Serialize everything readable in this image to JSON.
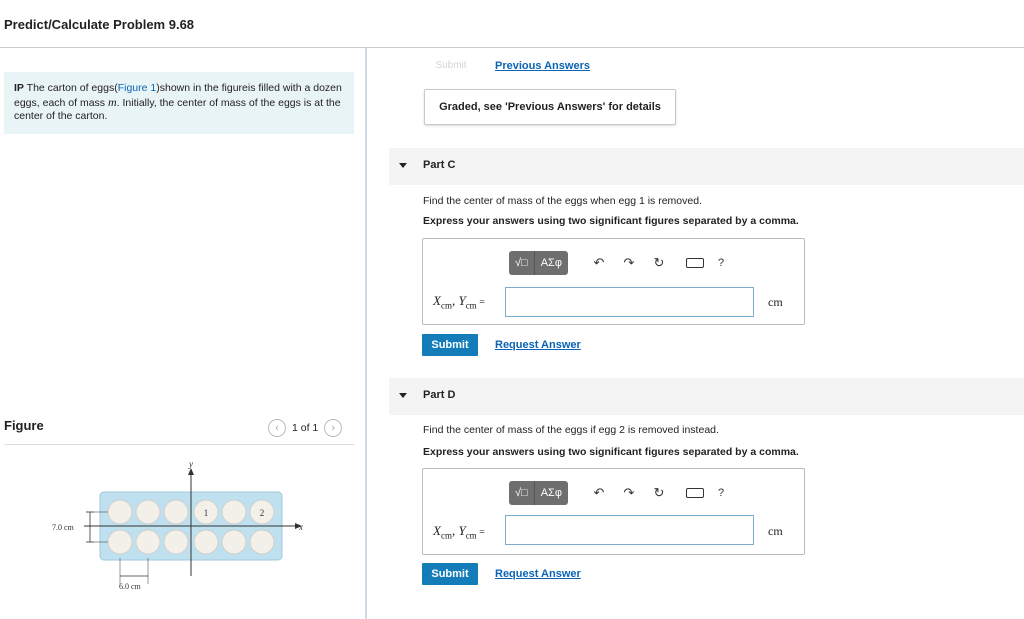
{
  "header": {
    "title": "Predict/Calculate Problem 9.68"
  },
  "intro": {
    "prefix": "IP",
    "text_before_link": " The carton of eggs(",
    "link": "Figure 1",
    "text_after_link": ")shown in the figureis filled with a dozen eggs, each of mass ",
    "mass_symbol": "m",
    "text_end": ". Initially, the center of mass of the eggs is at the center of the carton."
  },
  "figure": {
    "heading": "Figure",
    "pager": "1 of 1",
    "prev_icon": "chevron-left-icon",
    "next_icon": "chevron-right-icon",
    "axis_x": "x",
    "axis_y": "y",
    "height_label": "7.0 cm",
    "width_label": "6.0 cm",
    "egg_1": "1",
    "egg_2": "2"
  },
  "top": {
    "submit_label": "Submit",
    "previous_answers": "Previous Answers",
    "graded": "Graded, see 'Previous Answers' for details"
  },
  "parts": [
    {
      "label": "Part C",
      "question": "Find the center of mass of the eggs when egg 1 is removed.",
      "instruction": "Express your answers using two significant figures separated by a comma.",
      "var_x": "X",
      "sub_x": "cm",
      "var_y": "Y",
      "sub_y": "cm",
      "equals": " =",
      "unit": "cm",
      "submit": "Submit",
      "request": "Request Answer"
    },
    {
      "label": "Part D",
      "question": "Find the center of mass of the eggs if egg 2 is removed instead.",
      "instruction": "Express your answers using two significant figures separated by a comma.",
      "var_x": "X",
      "sub_x": "cm",
      "var_y": "Y",
      "sub_y": "cm",
      "equals": " =",
      "unit": "cm",
      "submit": "Submit",
      "request": "Request Answer"
    }
  ],
  "toolbar": {
    "templates": "√□",
    "symbols": "ΑΣφ",
    "undo_icon": "undo-icon",
    "redo_icon": "redo-icon",
    "reset_icon": "reset-icon",
    "keyboard_icon": "keyboard-icon",
    "help": "?"
  },
  "colors": {
    "accent": "#147db9",
    "link": "#0b64b5",
    "intro_bg": "#e9f4f6",
    "carton": "#bfe0ee"
  }
}
